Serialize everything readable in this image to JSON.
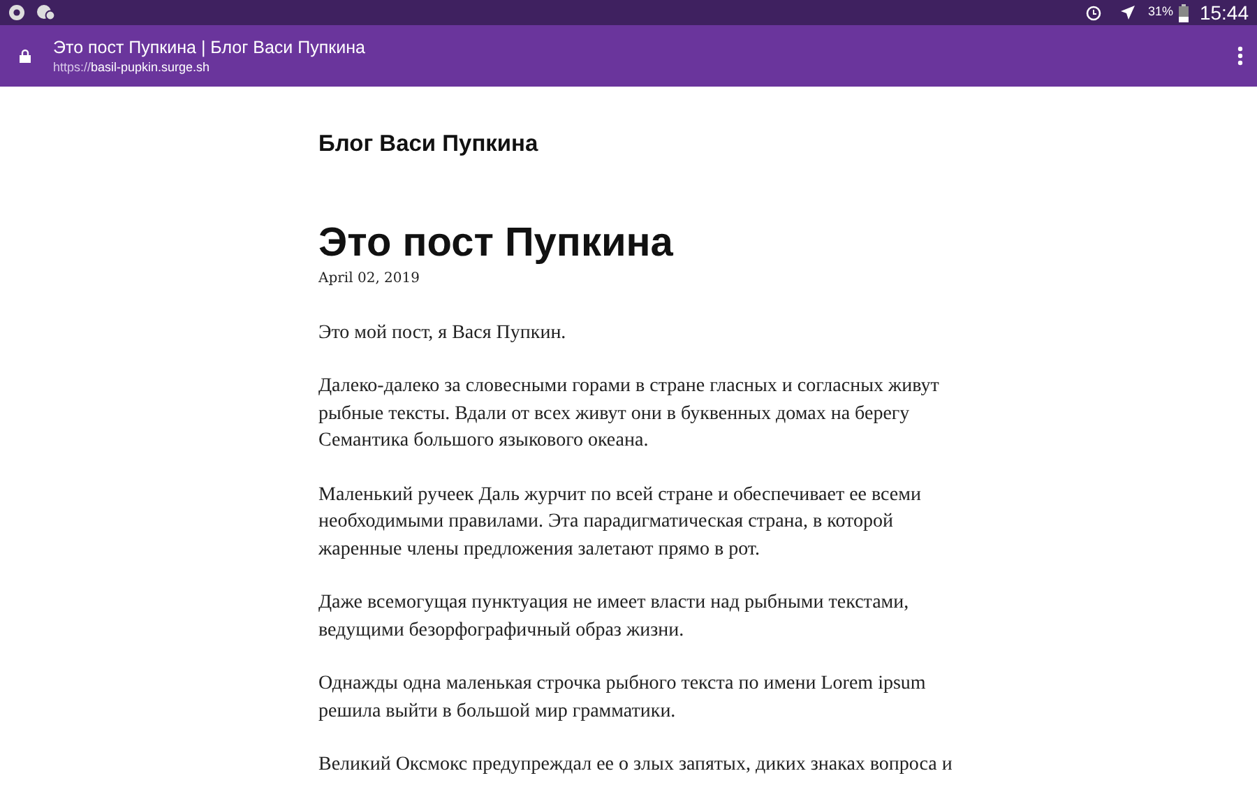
{
  "status_bar": {
    "battery": "31%",
    "time": "15:44"
  },
  "browser": {
    "page_title": "Это пост Пупкина | Блог Васи Пупкина",
    "url_scheme": "https://",
    "url_host": "basil-pupkin.surge.sh"
  },
  "site_title": "Блог Васи Пупкина",
  "post": {
    "title": "Это пост Пупкина",
    "date": "April 02, 2019",
    "paragraphs": [
      "Это мой пост, я Вася Пупкин.",
      "Далеко-далеко за словесными горами в стране гласных и согласных живут рыбные тексты. Вдали от всех живут они в буквенных домах на берегу Семантика большого языкового океана.",
      "Маленький ручеек Даль журчит по всей стране и обеспечивает ее всеми необходимыми правилами. Эта парадигматическая страна, в которой жаренные члены предложения залетают прямо в рот.",
      "Даже всемогущая пунктуация не имеет власти над рыбными текстами, ведущими безорфографичный образ жизни.",
      "Однажды одна маленькая строчка рыбного текста по имени Lorem ipsum решила выйти в большой мир грамматики.",
      "Великий Оксмокс предупреждал ее о злых запятых, диких знаках вопроса и"
    ]
  }
}
